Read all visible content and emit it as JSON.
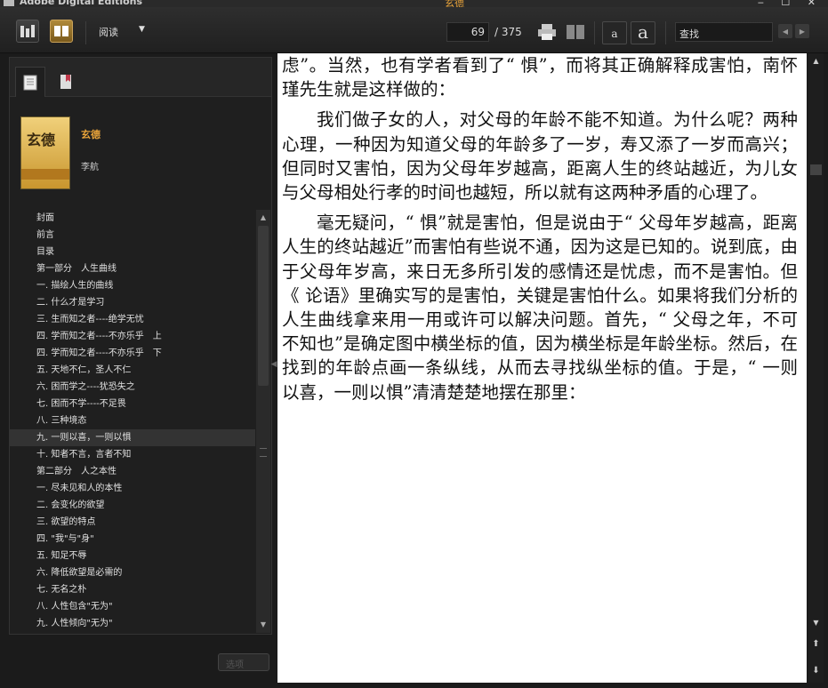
{
  "window": {
    "app_title": "Adobe Digital Editions",
    "doc_title": "玄德",
    "controls": "‒ ☐ ✕"
  },
  "toolbar": {
    "view_mode": "阅读",
    "current_page": "69",
    "total_pages": "/ 375",
    "font_small": "a",
    "font_large": "a",
    "search_placeholder": "查找"
  },
  "book": {
    "title": "玄德",
    "author": "李航",
    "cover_text": "玄德"
  },
  "toc": [
    "封面",
    "前言",
    "目录",
    "第一部分　人生曲线",
    "一. 描绘人生的曲线",
    "二. 什么才是学习",
    "三. 生而知之者----绝学无忧",
    "四. 学而知之者----不亦乐乎　上",
    "四. 学而知之者----不亦乐乎　下",
    "五. 天地不仁，圣人不仁",
    "六. 困而学之----犹恐失之",
    "七. 困而不学----不足畏",
    "八. 三种境态",
    "九. 一则以喜，一则以惧",
    "十. 知者不言，言者不知",
    "第二部分　人之本性",
    "一. 尽未见和人的本性",
    "二. 会变化的欲望",
    "三. 欲望的特点",
    "四. \"我\"与\"身\"",
    "五. 知足不辱",
    "六. 降低欲望是必需的",
    "七. 无名之朴",
    "八. 人性包含\"无为\"",
    "九. 人性倾向\"无为\""
  ],
  "toc_selected_index": 13,
  "footer": {
    "left_dropdown": "选项"
  },
  "content": {
    "paragraphs": [
      "虑”。当然，也有学者看到了“ 惧”，而将其正确解释成害怕，南怀瑾先生就是这样做的：",
      "我们做子女的人，对父母的年龄不能不知道。为什么呢？两种心理，一种因为知道父母的年龄多了一岁，寿又添了一岁而高兴；但同时又害怕，因为父母年岁越高，距离人生的终站越近，为儿女与父母相处行孝的时间也越短，所以就有这两种矛盾的心理了。",
      "毫无疑问，“ 惧”就是害怕，但是说由于“ 父母年岁越高，距离人生的终站越近”而害怕有些说不通，因为这是已知的。说到底，由于父母年岁高，来日无多所引发的感情还是忧虑，而不是害怕。但《 论语》里确实写的是害怕，关键是害怕什么。如果将我们分析的人生曲线拿来用一用或许可以解决问题。首先，“ 父母之年，不可不知也”是确定图中横坐标的值，因为横坐标是年龄坐标。然后，在找到的年龄点画一条纵线，从而去寻找纵坐标的值。于是，“ 一则以喜，一则以惧”清清楚楚地摆在那里："
    ]
  },
  "colors": {
    "accent": "#e8a33a",
    "chrome_bg": "#1b1b1b",
    "page_bg": "#ffffff"
  }
}
